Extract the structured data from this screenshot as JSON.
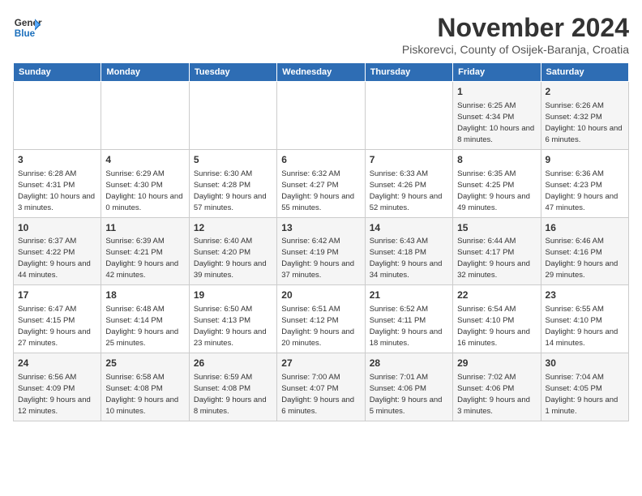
{
  "logo": {
    "line1": "General",
    "line2": "Blue"
  },
  "header": {
    "month": "November 2024",
    "location": "Piskorevci, County of Osijek-Baranja, Croatia"
  },
  "weekdays": [
    "Sunday",
    "Monday",
    "Tuesday",
    "Wednesday",
    "Thursday",
    "Friday",
    "Saturday"
  ],
  "weeks": [
    [
      {
        "day": "",
        "info": ""
      },
      {
        "day": "",
        "info": ""
      },
      {
        "day": "",
        "info": ""
      },
      {
        "day": "",
        "info": ""
      },
      {
        "day": "",
        "info": ""
      },
      {
        "day": "1",
        "info": "Sunrise: 6:25 AM\nSunset: 4:34 PM\nDaylight: 10 hours and 8 minutes."
      },
      {
        "day": "2",
        "info": "Sunrise: 6:26 AM\nSunset: 4:32 PM\nDaylight: 10 hours and 6 minutes."
      }
    ],
    [
      {
        "day": "3",
        "info": "Sunrise: 6:28 AM\nSunset: 4:31 PM\nDaylight: 10 hours and 3 minutes."
      },
      {
        "day": "4",
        "info": "Sunrise: 6:29 AM\nSunset: 4:30 PM\nDaylight: 10 hours and 0 minutes."
      },
      {
        "day": "5",
        "info": "Sunrise: 6:30 AM\nSunset: 4:28 PM\nDaylight: 9 hours and 57 minutes."
      },
      {
        "day": "6",
        "info": "Sunrise: 6:32 AM\nSunset: 4:27 PM\nDaylight: 9 hours and 55 minutes."
      },
      {
        "day": "7",
        "info": "Sunrise: 6:33 AM\nSunset: 4:26 PM\nDaylight: 9 hours and 52 minutes."
      },
      {
        "day": "8",
        "info": "Sunrise: 6:35 AM\nSunset: 4:25 PM\nDaylight: 9 hours and 49 minutes."
      },
      {
        "day": "9",
        "info": "Sunrise: 6:36 AM\nSunset: 4:23 PM\nDaylight: 9 hours and 47 minutes."
      }
    ],
    [
      {
        "day": "10",
        "info": "Sunrise: 6:37 AM\nSunset: 4:22 PM\nDaylight: 9 hours and 44 minutes."
      },
      {
        "day": "11",
        "info": "Sunrise: 6:39 AM\nSunset: 4:21 PM\nDaylight: 9 hours and 42 minutes."
      },
      {
        "day": "12",
        "info": "Sunrise: 6:40 AM\nSunset: 4:20 PM\nDaylight: 9 hours and 39 minutes."
      },
      {
        "day": "13",
        "info": "Sunrise: 6:42 AM\nSunset: 4:19 PM\nDaylight: 9 hours and 37 minutes."
      },
      {
        "day": "14",
        "info": "Sunrise: 6:43 AM\nSunset: 4:18 PM\nDaylight: 9 hours and 34 minutes."
      },
      {
        "day": "15",
        "info": "Sunrise: 6:44 AM\nSunset: 4:17 PM\nDaylight: 9 hours and 32 minutes."
      },
      {
        "day": "16",
        "info": "Sunrise: 6:46 AM\nSunset: 4:16 PM\nDaylight: 9 hours and 29 minutes."
      }
    ],
    [
      {
        "day": "17",
        "info": "Sunrise: 6:47 AM\nSunset: 4:15 PM\nDaylight: 9 hours and 27 minutes."
      },
      {
        "day": "18",
        "info": "Sunrise: 6:48 AM\nSunset: 4:14 PM\nDaylight: 9 hours and 25 minutes."
      },
      {
        "day": "19",
        "info": "Sunrise: 6:50 AM\nSunset: 4:13 PM\nDaylight: 9 hours and 23 minutes."
      },
      {
        "day": "20",
        "info": "Sunrise: 6:51 AM\nSunset: 4:12 PM\nDaylight: 9 hours and 20 minutes."
      },
      {
        "day": "21",
        "info": "Sunrise: 6:52 AM\nSunset: 4:11 PM\nDaylight: 9 hours and 18 minutes."
      },
      {
        "day": "22",
        "info": "Sunrise: 6:54 AM\nSunset: 4:10 PM\nDaylight: 9 hours and 16 minutes."
      },
      {
        "day": "23",
        "info": "Sunrise: 6:55 AM\nSunset: 4:10 PM\nDaylight: 9 hours and 14 minutes."
      }
    ],
    [
      {
        "day": "24",
        "info": "Sunrise: 6:56 AM\nSunset: 4:09 PM\nDaylight: 9 hours and 12 minutes."
      },
      {
        "day": "25",
        "info": "Sunrise: 6:58 AM\nSunset: 4:08 PM\nDaylight: 9 hours and 10 minutes."
      },
      {
        "day": "26",
        "info": "Sunrise: 6:59 AM\nSunset: 4:08 PM\nDaylight: 9 hours and 8 minutes."
      },
      {
        "day": "27",
        "info": "Sunrise: 7:00 AM\nSunset: 4:07 PM\nDaylight: 9 hours and 6 minutes."
      },
      {
        "day": "28",
        "info": "Sunrise: 7:01 AM\nSunset: 4:06 PM\nDaylight: 9 hours and 5 minutes."
      },
      {
        "day": "29",
        "info": "Sunrise: 7:02 AM\nSunset: 4:06 PM\nDaylight: 9 hours and 3 minutes."
      },
      {
        "day": "30",
        "info": "Sunrise: 7:04 AM\nSunset: 4:05 PM\nDaylight: 9 hours and 1 minute."
      }
    ]
  ]
}
